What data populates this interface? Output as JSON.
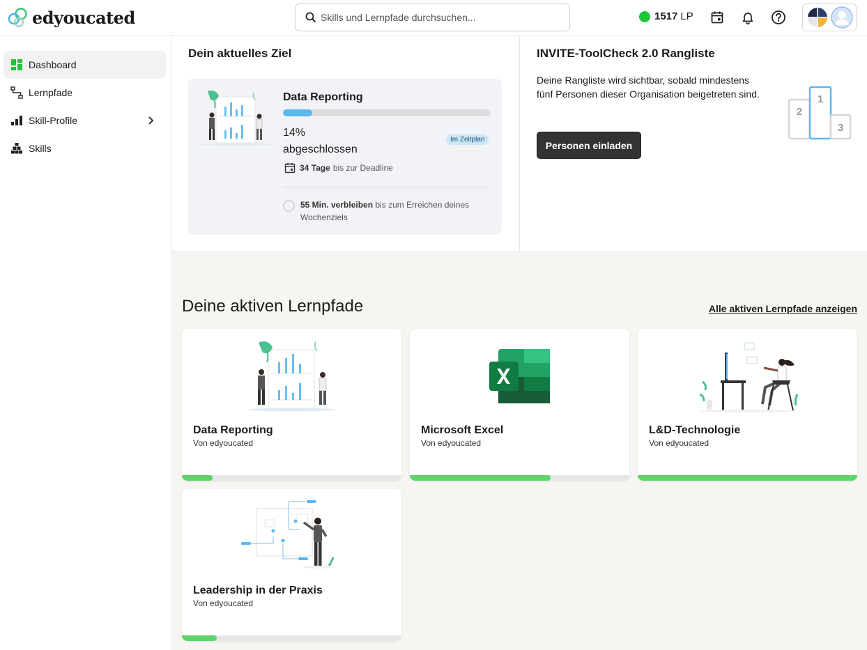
{
  "header": {
    "logo_text": "edyoucated",
    "search_placeholder": "Skills und Lernpfade durchsuchen...",
    "points_value": "1517",
    "points_unit": "LP"
  },
  "sidebar": {
    "items": [
      {
        "label": "Dashboard",
        "icon": "dashboard-icon",
        "active": true
      },
      {
        "label": "Lernpfade",
        "icon": "learning-path-icon"
      },
      {
        "label": "Skill-Profile",
        "icon": "skill-profile-icon",
        "has_children": true
      },
      {
        "label": "Skills",
        "icon": "skills-icon"
      }
    ]
  },
  "goal": {
    "section_title": "Dein aktuelles Ziel",
    "name": "Data Reporting",
    "progress": 0.14,
    "pct_text": "14%",
    "status_text": "abgeschlossen",
    "badge": "Im Zeitplan",
    "deadline_days": "34 Tage",
    "deadline_suffix": "bis zur Deadline",
    "weekly_strong": "55 Min. verbleiben",
    "weekly_rest": "bis zum Erreichen deines Wochenziels"
  },
  "ranking": {
    "title": "INVITE-ToolCheck 2.0 Rangliste",
    "text": "Deine Rangliste wird sichtbar, sobald mindestens fünf Personen dieser Organisation beigetreten sind.",
    "button": "Personen einladen",
    "podium": [
      "1",
      "2",
      "3"
    ]
  },
  "paths": {
    "title": "Deine aktiven Lernpfade",
    "link": "Alle aktiven Lernpfade anzeigen",
    "cards": [
      {
        "title": "Data Reporting",
        "author": "Von edyoucated",
        "progress": 0.14
      },
      {
        "title": "Microsoft Excel",
        "author": "Von edyoucated",
        "progress": 0.64
      },
      {
        "title": "L&D-Technologie",
        "author": "Von edyoucated",
        "progress": 1.0
      },
      {
        "title": "Leadership in der Praxis",
        "author": "Von edyoucated",
        "progress": 0.16
      }
    ]
  },
  "colors": {
    "accent_green": "#22c43a",
    "progress_blue": "#5ab8f0",
    "progress_green": "#5fd36a",
    "excel_green": "#1e7145"
  }
}
